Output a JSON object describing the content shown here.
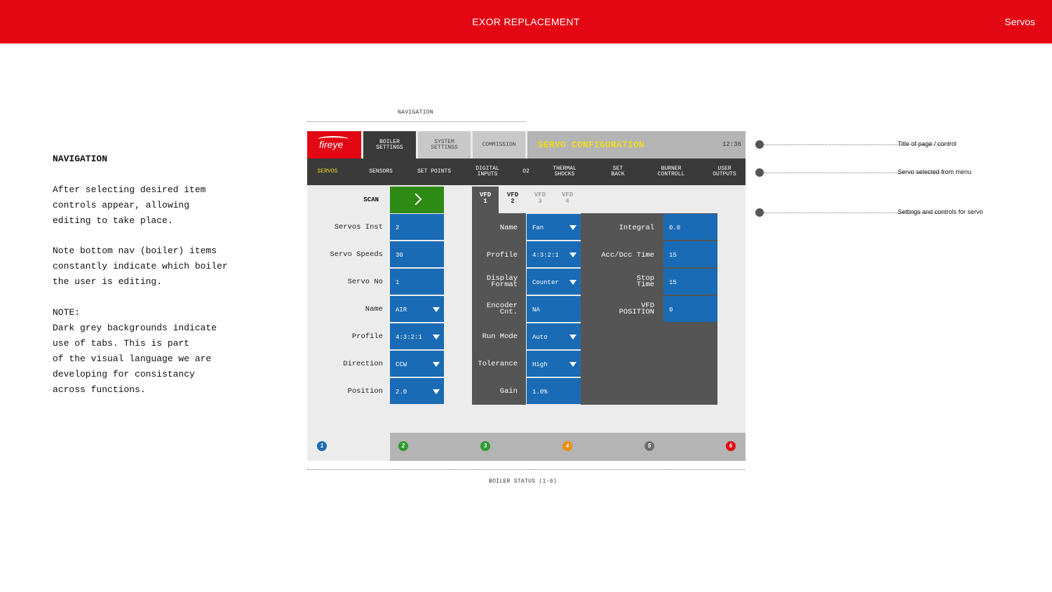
{
  "topbar": {
    "title": "EXOR REPLACEMENT",
    "section": "Servos"
  },
  "notes": {
    "heading": "NAVIGATION",
    "body": "After selecting desired item\ncontrols appear, allowing\nediting to take place.\n\nNote bottom nav (boiler) items\nconstantly indicate which boiler\nthe user is editing.\n\nNOTE:\nDark grey backgrounds indicate\nuse of tabs. This is part\nof the visual language we are\ndeveloping for consistancy\nacross functions."
  },
  "annotations": {
    "navigation": "NAVIGATION",
    "boiler_status": "BOILER STATUS (1-6)",
    "callouts": [
      "Title of page / control",
      "Servo selected from menu",
      "Settings and controls for servo"
    ]
  },
  "device": {
    "logo": "fireye",
    "tabs": [
      "BOILER\nSETTINGS",
      "SYSTEM\nSETTINGS",
      "COMMISSION"
    ],
    "page_title": "SERVO CONFIGURATION",
    "clock": "12:36",
    "subnav": [
      "SERVOS",
      "SENSORS",
      "SET POINTS",
      "DIGITAL\nINPUTS",
      "O2",
      "THERMAL\nSHOCKS",
      "SET\nBACK",
      "BURNER\nCONTROLL",
      "USER\nOUTPUTS"
    ],
    "scan_label": "SCAN",
    "left_fields": [
      {
        "label": "Servos Inst",
        "value": "2"
      },
      {
        "label": "Servo Speeds",
        "value": "30"
      },
      {
        "label": "Servo No",
        "value": "1"
      },
      {
        "label": "Name",
        "value": "AIR"
      },
      {
        "label": "Profile",
        "value": "4:3:2:1"
      },
      {
        "label": "Direction",
        "value": "CCW"
      },
      {
        "label": "Position",
        "value": "2.0"
      }
    ],
    "vfd_tabs": [
      "VFD\n1",
      "VFD\n2",
      "VFD\n3",
      "VFD\n4"
    ],
    "mid_fields": [
      {
        "label": "Name",
        "value": "Fan"
      },
      {
        "label": "Profile",
        "value": "4:3:2:1"
      },
      {
        "label": "Display\nFormat",
        "value": "Counter"
      },
      {
        "label": "Encoder\nCnt.",
        "value": "NA"
      },
      {
        "label": "Run Mode",
        "value": "Auto"
      },
      {
        "label": "Tolerance",
        "value": "High"
      },
      {
        "label": "Gain",
        "value": "1.0%"
      }
    ],
    "right_fields": [
      {
        "label": "Integral",
        "value": "0.0"
      },
      {
        "label": "Acc/Dcc Time",
        "value": "15"
      },
      {
        "label": "Stop\nTime",
        "value": "15"
      },
      {
        "label": "VFD\nPOSITION",
        "value": "0"
      }
    ],
    "boilers": [
      {
        "label": "1",
        "color": "#1a6bb5"
      },
      {
        "label": "2",
        "color": "#2d9a2d"
      },
      {
        "label": "3",
        "color": "#2d9a2d"
      },
      {
        "label": "4",
        "color": "#f08c00"
      },
      {
        "label": "5",
        "color": "#6e6e6e"
      },
      {
        "label": "6",
        "color": "#e30613"
      }
    ]
  },
  "colors": {
    "brand_red": "#e30613",
    "field_blue": "#1a6bb5",
    "tab_dark": "#3a3a3a",
    "panel_grey": "#555555",
    "title_yellow": "#f0dc1e",
    "scan_green": "#2d8a14"
  },
  "icons": {
    "scan": "chevron-right-icon",
    "dropdown": "caret-down-icon"
  }
}
